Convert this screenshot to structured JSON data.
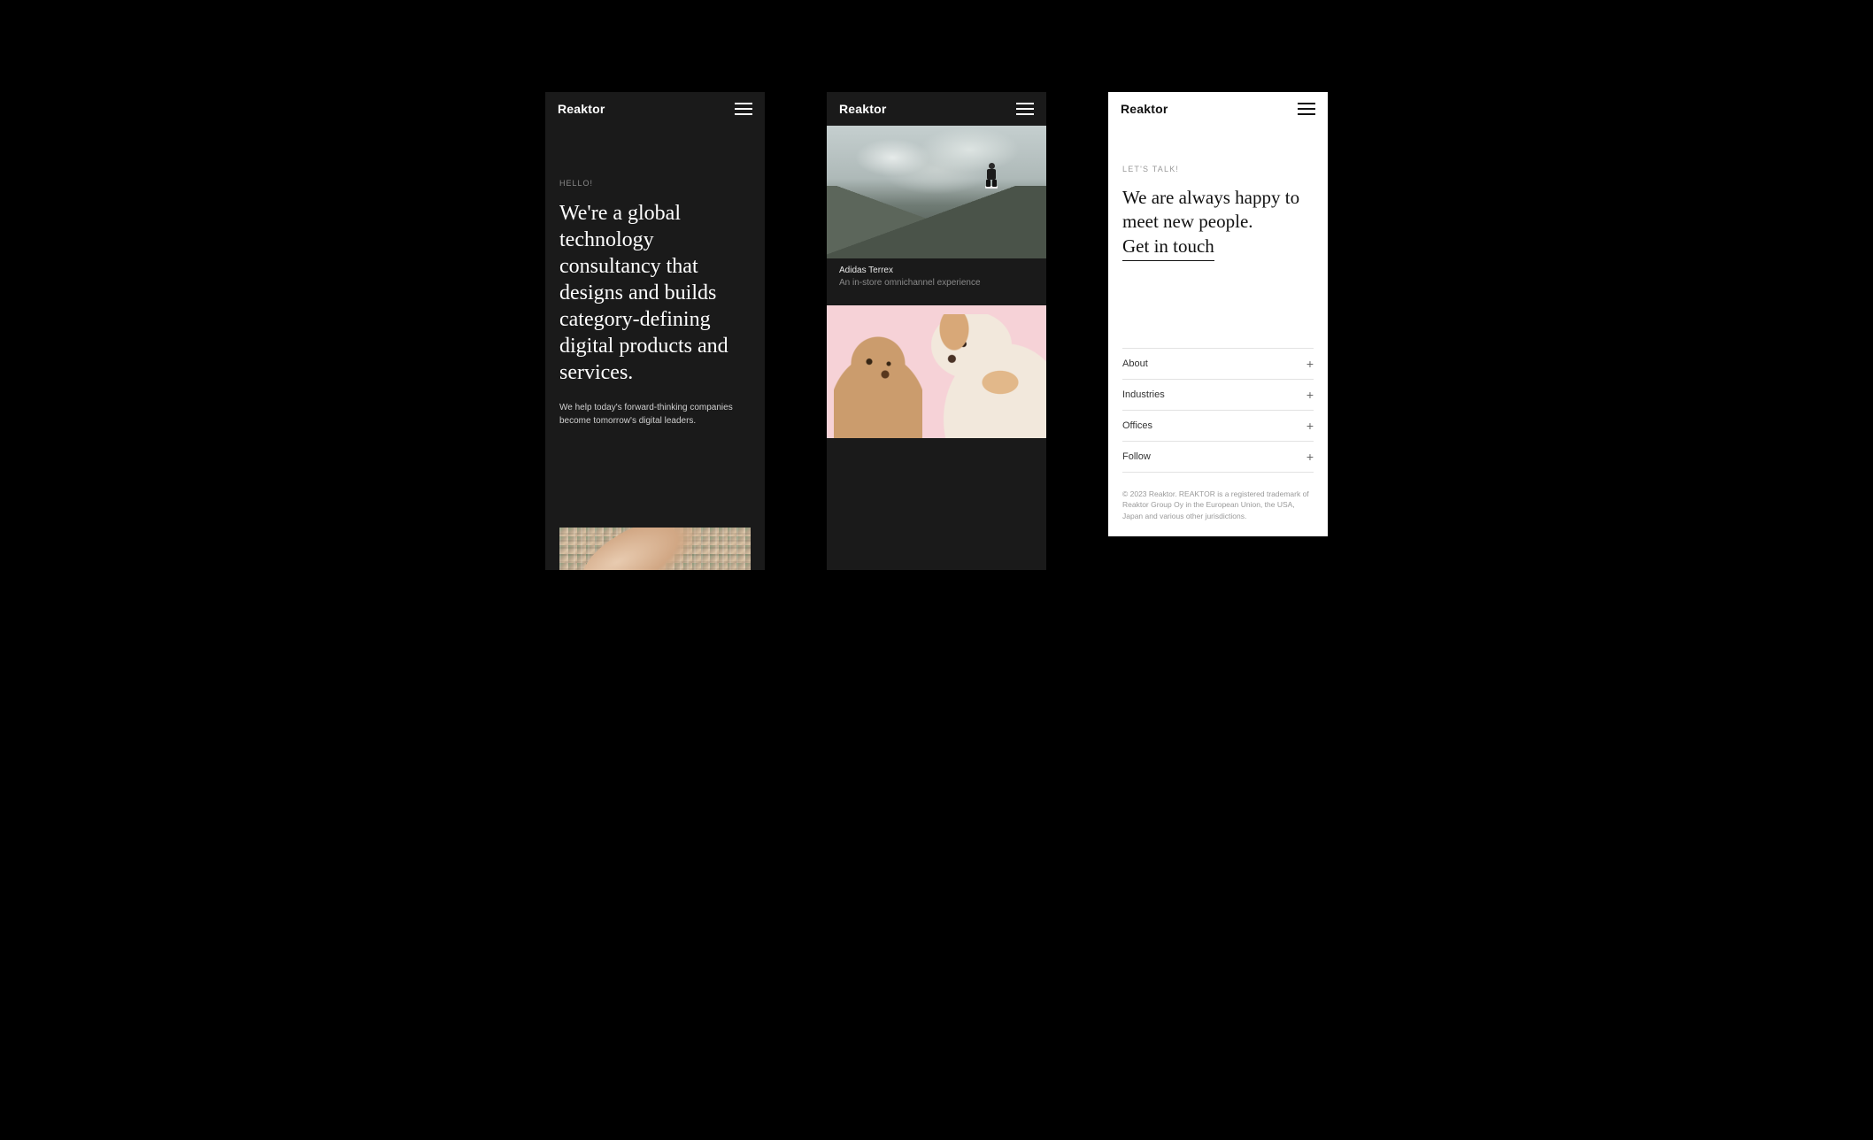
{
  "brand": "Reaktor",
  "screen1": {
    "eyebrow": "HELLO!",
    "hero": "We're a global technology consultancy that designs and builds category-defining digital products and services.",
    "sub": "We help today's forward-thinking companies become tomorrow's digital leaders."
  },
  "screen2": {
    "card1": {
      "title": "Adidas Terrex",
      "sub": "An in-store omnichannel experience"
    }
  },
  "screen3": {
    "eyebrow": "LET'S TALK!",
    "hero_line1": "We are always happy to meet new people.",
    "cta": "Get in touch",
    "menu": [
      "About",
      "Industries",
      "Offices",
      "Follow"
    ],
    "legal": "© 2023 Reaktor. REAKTOR is a registered trademark of Reaktor Group Oy in the European Union, the USA, Japan and various other jurisdictions."
  }
}
